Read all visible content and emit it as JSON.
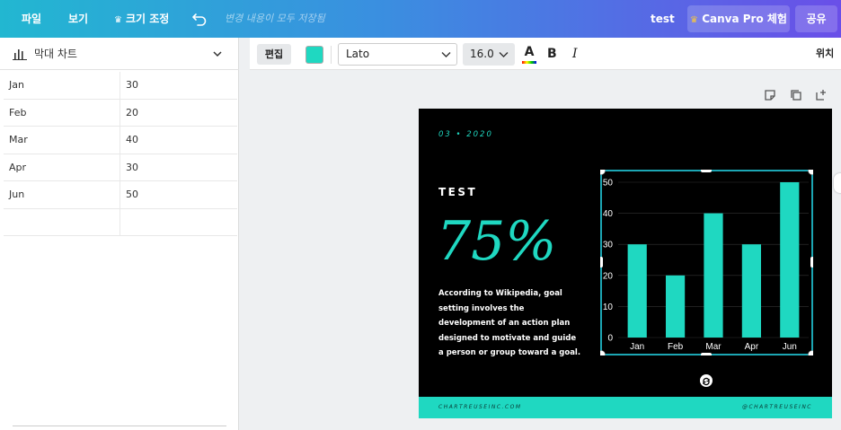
{
  "topbar": {
    "file_label": "파일",
    "view_label": "보기",
    "resize_label": "크기 조정",
    "status_text": "변경 내용이 모두 저장됨",
    "doc_title": "test",
    "pro_label": "Canva Pro 체험",
    "share_label": "공유"
  },
  "left_panel": {
    "chart_type_label": "막대 차트",
    "rows": [
      [
        "Jan",
        "30"
      ],
      [
        "Feb",
        "20"
      ],
      [
        "Mar",
        "40"
      ],
      [
        "Apr",
        "30"
      ],
      [
        "Jun",
        "50"
      ],
      [
        "",
        ""
      ]
    ]
  },
  "toolbar": {
    "edit_label": "편집",
    "color_swatch": "#1fd8c1",
    "font_name": "Lato",
    "font_size": "16.0",
    "text_color_label": "A",
    "bold_label": "B",
    "italic_label": "I",
    "position_label": "위치"
  },
  "card": {
    "date": "03 • 2020",
    "title": "TEST",
    "percent": "75%",
    "description": "According to Wikipedia, goal setting involves the development of an action plan designed to motivate and guide a person or group toward a goal.",
    "footer_left": "CHARTREUSEINC.COM",
    "footer_right": "@CHARTREUSEINC",
    "accent_color": "#1fd8c1"
  },
  "chart_data": {
    "type": "bar",
    "categories": [
      "Jan",
      "Feb",
      "Mar",
      "Apr",
      "Jun"
    ],
    "values": [
      30,
      20,
      40,
      30,
      50
    ],
    "yticks": [
      0,
      10,
      20,
      30,
      40,
      50
    ],
    "ylim": [
      0,
      50
    ],
    "grid": true,
    "color": "#1fd8c1"
  }
}
